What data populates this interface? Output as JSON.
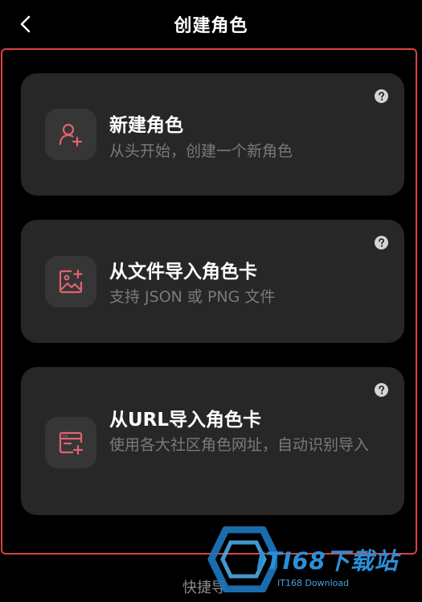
{
  "header": {
    "back_icon": "chevron-left-icon",
    "title": "创建角色"
  },
  "colors": {
    "accent": "#e0636e",
    "card_bg": "#272727",
    "highlight_border": "#d9433f"
  },
  "cards": [
    {
      "icon": "user-plus-icon",
      "title": "新建角色",
      "description": "从头开始，创建一个新角色",
      "help_icon": "question-circle-icon"
    },
    {
      "icon": "image-plus-icon",
      "title": "从文件导入角色卡",
      "description": "支持 JSON 或 PNG 文件",
      "help_icon": "question-circle-icon"
    },
    {
      "icon": "browser-plus-icon",
      "title": "从URL导入角色卡",
      "description": "使用各大社区角色网址，自动识别导入",
      "help_icon": "question-circle-icon"
    }
  ],
  "footer": {
    "quick_label": "快捷导"
  },
  "watermark": {
    "text": "ITI68下载站",
    "sub": "IT168 Download"
  }
}
